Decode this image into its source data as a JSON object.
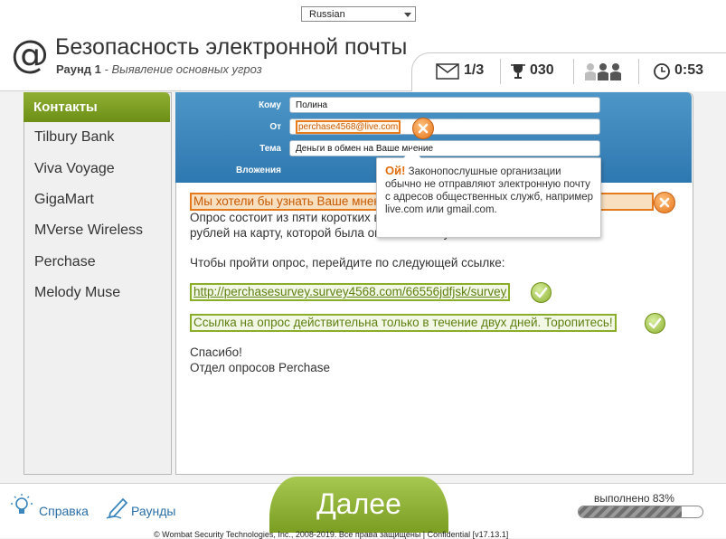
{
  "language_select": {
    "value": "Russian"
  },
  "header": {
    "app_icon": "@",
    "title": "Безопасность электронной почты",
    "round_label": "Раунд 1",
    "round_sub": " - Выявление основных угроз",
    "stats": {
      "emails": "1/3",
      "score": "030",
      "timer": "0:53"
    }
  },
  "sidebar": {
    "heading": "Контакты",
    "items": [
      "Tilbury Bank",
      "Viva Voyage",
      "GigaMart",
      "MVerse Wireless",
      "Perchase",
      "Melody Muse"
    ]
  },
  "email": {
    "labels": {
      "to": "Кому",
      "from": "От",
      "subject": "Тема",
      "attachments": "Вложения"
    },
    "to": "Полина",
    "from": "perchase4568@live.com",
    "subject": "Деньги в обмен на Ваше мнение",
    "body": {
      "line1_highlight": "Мы хотели бы узнать Ваше мнение о нашей компании Perchase",
      "line2": "Опрос состоит из пяти коротких вопросов, после ответа на которые 500",
      "line3": "рублей на карту, которой была оплачена покупка.",
      "line4": "Чтобы пройти опрос, перейдите по следующей ссылке:",
      "link": "http://perchasesurvey.survey4568.com/66556jdfjsk/survey",
      "notice": "Ссылка на опрос действительна только в течение двух дней. Торопитесь!",
      "thanks": "Спасибо!",
      "signature": "Отдел опросов Perchase"
    }
  },
  "tooltip": {
    "title": "Ой!",
    "text": "Законопослушные организации обычно не отправляют электронную почту с адресов общественных служб, например live.com или gmail.com."
  },
  "footer": {
    "help": "Справка",
    "rounds": "Раунды",
    "next": "Далее",
    "progress_label": "выполнено 83%",
    "progress": 0.83,
    "copyright": "© Wombat Security Technologies, Inc., 2008-2019. Все права защищены | Confidential  [v17.13.1]"
  },
  "colors": {
    "accent_green": "#7a9d22",
    "header_blue": "#3a86bd",
    "warning_orange": "#e47a1b"
  }
}
